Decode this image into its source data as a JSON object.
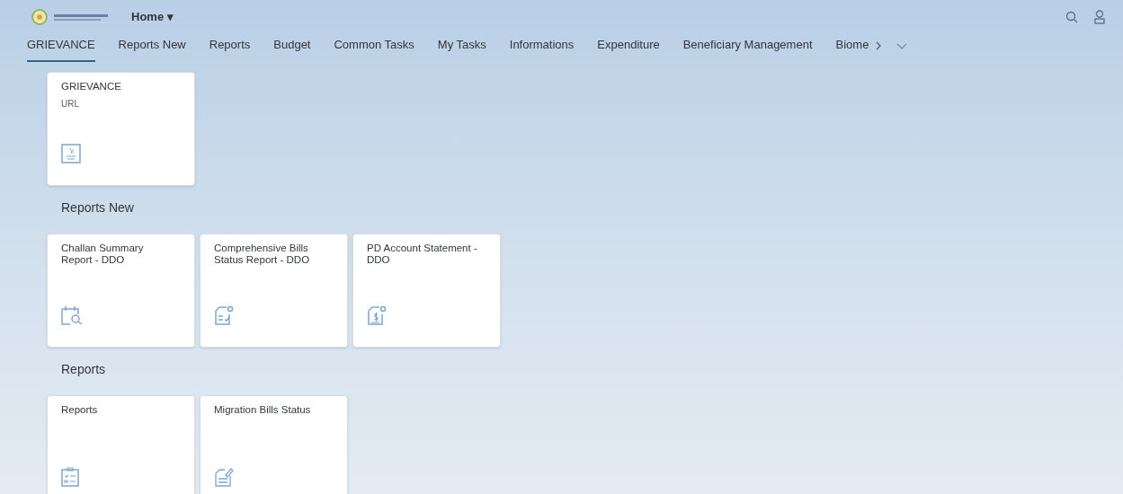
{
  "header": {
    "home_menu": "Home ▾"
  },
  "tabs": [
    {
      "label": "GRIEVANCE",
      "selected": true
    },
    {
      "label": "Reports New",
      "selected": false
    },
    {
      "label": "Reports",
      "selected": false
    },
    {
      "label": "Budget",
      "selected": false
    },
    {
      "label": "Common Tasks",
      "selected": false
    },
    {
      "label": "My Tasks",
      "selected": false
    },
    {
      "label": "Informations",
      "selected": false
    },
    {
      "label": "Expenditure",
      "selected": false
    },
    {
      "label": "Beneficiary Management",
      "selected": false
    },
    {
      "label": "Biome",
      "selected": false
    }
  ],
  "sections": [
    {
      "tiles": [
        {
          "title": "GRIEVANCE",
          "subtitle": "URL",
          "kind": "cup"
        }
      ]
    },
    {
      "heading": "Reports New",
      "tiles": [
        {
          "title": "Challan Summary Report - DDO",
          "kind": "calendar"
        },
        {
          "title": "Comprehensive Bills Status Report - DDO",
          "kind": "checklist"
        },
        {
          "title": "PD Account Statement - DDO",
          "kind": "dollar"
        }
      ]
    },
    {
      "heading": "Reports",
      "tiles": [
        {
          "title": "Reports",
          "kind": "clipboard"
        },
        {
          "title": "Migration Bills Status",
          "kind": "pen"
        }
      ]
    }
  ]
}
